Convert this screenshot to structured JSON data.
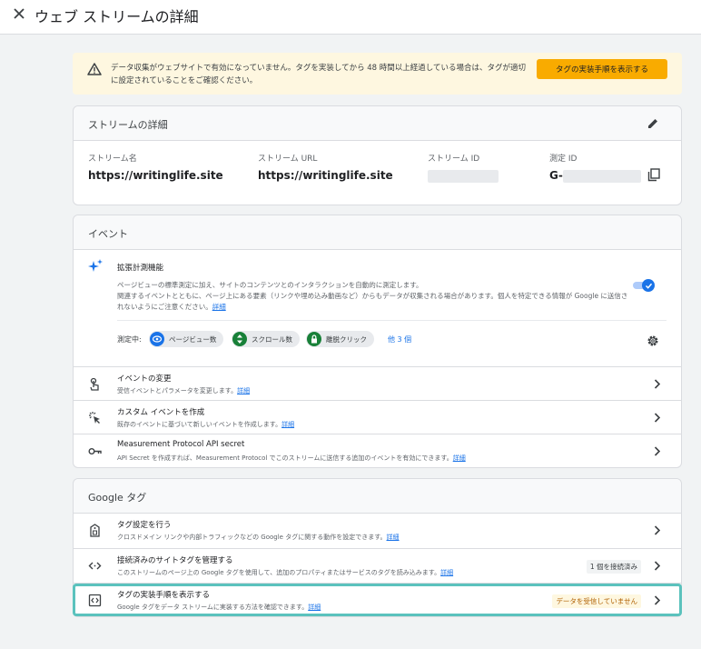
{
  "header": {
    "title": "ウェブ ストリームの詳細"
  },
  "alert": {
    "text": "データ収集がウェブサイトで有効になっていません。タグを実装してから 48 時間以上経過している場合は、タグが適切に設定されていることをご確認ください。",
    "button": "タグの実装手順を表示する"
  },
  "stream_details": {
    "title": "ストリームの詳細",
    "fields": [
      {
        "label": "ストリーム名",
        "value": "https://writinglife.site"
      },
      {
        "label": "ストリーム URL",
        "value": "https://writinglife.site"
      },
      {
        "label": "ストリーム ID",
        "value": ""
      },
      {
        "label": "測定 ID",
        "value": "G-"
      }
    ]
  },
  "events": {
    "title": "イベント",
    "enhanced": {
      "title": "拡張計測機能",
      "desc_1": "ページビューの標準測定に加え、サイトのコンテンツとのインタラクションを自動的に測定します。",
      "desc_2": "関連するイベントとともに、ページ上にある要素（リンクや埋め込み動画など）からもデータが収集される場合があります。個人を特定できる情報が Google に送信されないようにご注意ください。",
      "link": "詳細",
      "toggle_on": true,
      "measuring_label": "測定中:",
      "chips": [
        "ページビュー数",
        "スクロール数",
        "離脱クリック"
      ],
      "more": "他 3 個"
    },
    "rows": [
      {
        "title": "イベントの変更",
        "desc": "受信イベントとパラメータを変更します。",
        "link": "詳細"
      },
      {
        "title": "カスタム イベントを作成",
        "desc": "既存のイベントに基づいて新しいイベントを作成します。",
        "link": "詳細"
      },
      {
        "title": "Measurement Protocol API secret",
        "desc": "API Secret を作成すれば、Measurement Protocol でこのストリームに送信する追加のイベントを有効にできます。",
        "link": "詳細"
      }
    ]
  },
  "google_tag": {
    "title": "Google タグ",
    "rows": [
      {
        "title": "タグ設定を行う",
        "desc": "クロスドメイン リンクや内部トラフィックなどの Google タグに関する動作を設定できます。",
        "link": "詳細",
        "badge": ""
      },
      {
        "title": "接続済みのサイトタグを管理する",
        "desc": "このストリームのページ上の Google タグを使用して、追加のプロパティまたはサービスのタグを読み込みます。",
        "link": "詳細",
        "badge": "1 個を接続済み"
      },
      {
        "title": "タグの実装手順を表示する",
        "desc": "Google タグをデータ ストリームに実装する方法を確認できます。",
        "link": "詳細",
        "badge": "データを受信していません"
      }
    ]
  },
  "colors": {
    "accent": "#1a73e8",
    "warning_bg": "#fef7e0",
    "warning_button": "#f9ab00",
    "highlight": "#5bc2bd",
    "badge_warning_bg": "#fef7e0",
    "badge_warning_text": "#b06000"
  }
}
